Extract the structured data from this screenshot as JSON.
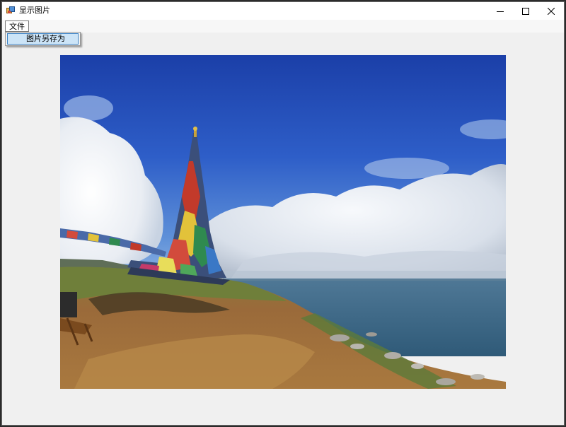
{
  "window": {
    "title": "显示图片"
  },
  "menubar": {
    "file_label": "文件"
  },
  "file_menu": {
    "items": [
      {
        "label": "图片另存为"
      }
    ]
  },
  "picture": {
    "subject": "prayer-flag-pole-by-lake-photo"
  },
  "colors": {
    "window_bg": "#f0f0f0",
    "titlebar_bg": "#ffffff",
    "menu_highlight": "#cce4f7",
    "menu_highlight_border": "#3d84c6"
  }
}
